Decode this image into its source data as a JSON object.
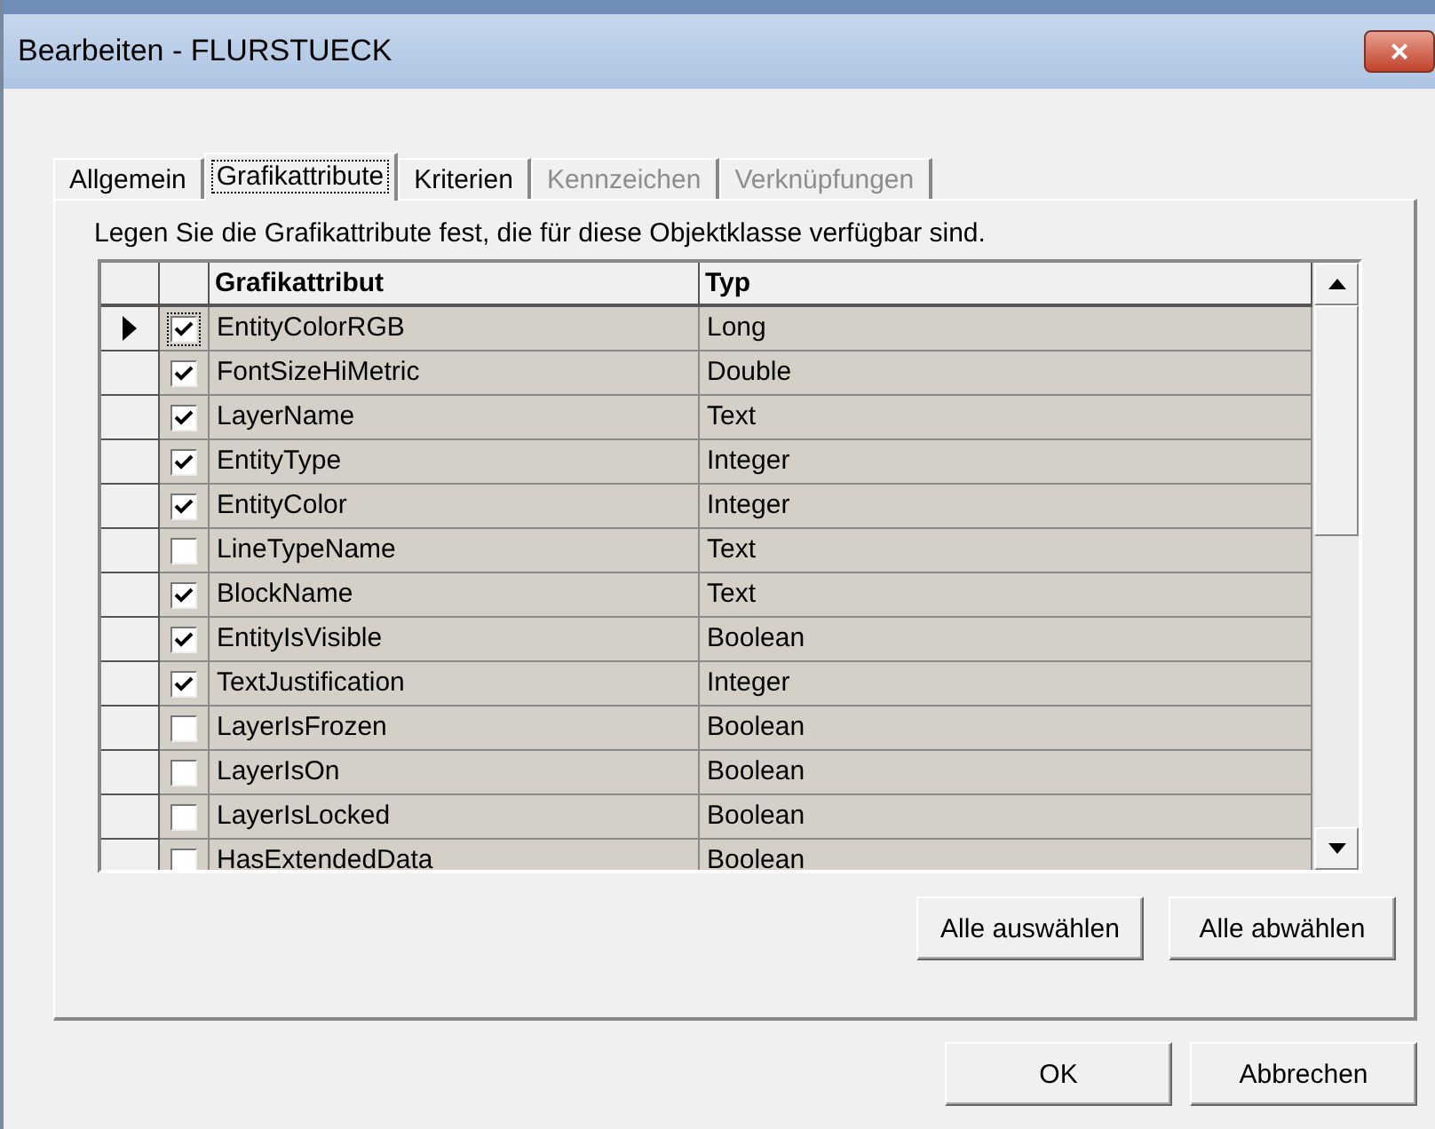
{
  "window": {
    "title": "Bearbeiten - FLURSTUECK",
    "close": "×"
  },
  "tabs": [
    {
      "label": "Allgemein",
      "selected": false,
      "disabled": false
    },
    {
      "label": "Grafikattribute",
      "selected": true,
      "disabled": false
    },
    {
      "label": "Kriterien",
      "selected": false,
      "disabled": false
    },
    {
      "label": "Kennzeichen",
      "selected": false,
      "disabled": true
    },
    {
      "label": "Verknüpfungen",
      "selected": false,
      "disabled": true
    }
  ],
  "description": "Legen Sie die Grafikattribute fest, die für diese Objektklasse verfügbar sind.",
  "table": {
    "columns": [
      "Grafikattribut",
      "Typ"
    ],
    "rows": [
      {
        "name": "EntityColorRGB",
        "type": "Long",
        "checked": true,
        "selected": true
      },
      {
        "name": "FontSizeHiMetric",
        "type": "Double",
        "checked": true,
        "selected": false
      },
      {
        "name": "LayerName",
        "type": "Text",
        "checked": true,
        "selected": false
      },
      {
        "name": "EntityType",
        "type": "Integer",
        "checked": true,
        "selected": false
      },
      {
        "name": "EntityColor",
        "type": "Integer",
        "checked": true,
        "selected": false
      },
      {
        "name": "LineTypeName",
        "type": "Text",
        "checked": false,
        "selected": false
      },
      {
        "name": "BlockName",
        "type": "Text",
        "checked": true,
        "selected": false
      },
      {
        "name": "EntityIsVisible",
        "type": "Boolean",
        "checked": true,
        "selected": false
      },
      {
        "name": "TextJustification",
        "type": "Integer",
        "checked": true,
        "selected": false
      },
      {
        "name": "LayerIsFrozen",
        "type": "Boolean",
        "checked": false,
        "selected": false
      },
      {
        "name": "LayerIsOn",
        "type": "Boolean",
        "checked": false,
        "selected": false
      },
      {
        "name": "LayerIsLocked",
        "type": "Boolean",
        "checked": false,
        "selected": false
      },
      {
        "name": "HasExtendedData",
        "type": "Boolean",
        "checked": false,
        "selected": false
      }
    ]
  },
  "panel_buttons": [
    "Alle auswählen",
    "Alle abwählen"
  ],
  "dialog_buttons": [
    "OK",
    "Abbrechen"
  ]
}
